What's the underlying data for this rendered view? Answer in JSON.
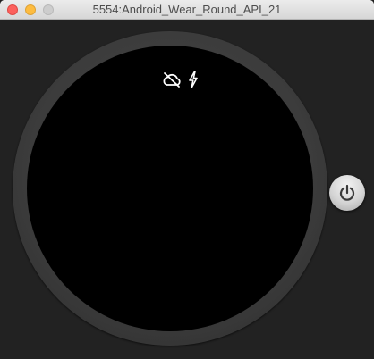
{
  "window": {
    "title": "5554:Android_Wear_Round_API_21"
  },
  "status_icons": [
    "cloud-off-icon",
    "bolt-icon"
  ],
  "power_button": {
    "icon": "power-icon"
  }
}
